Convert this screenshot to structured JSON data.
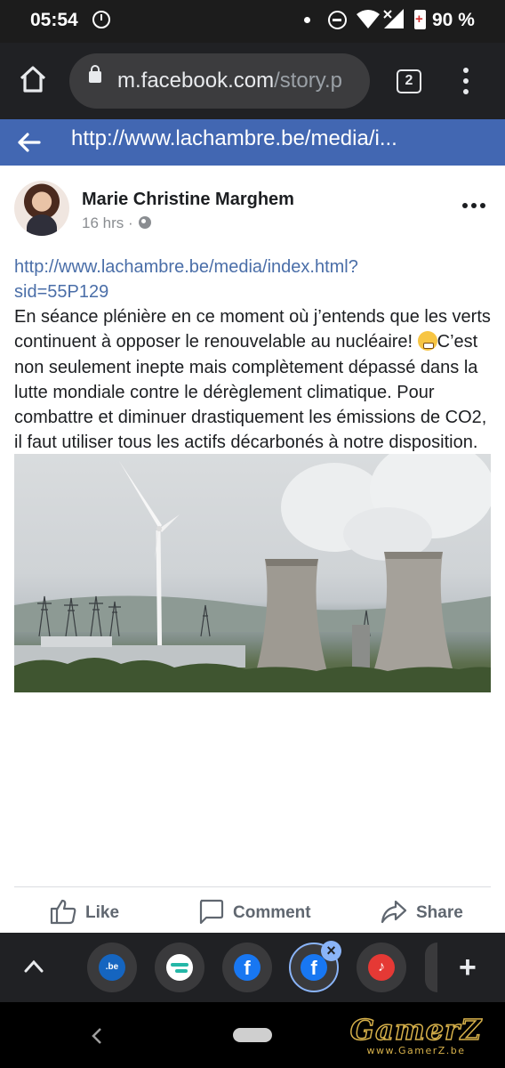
{
  "status_bar": {
    "time": "05:54",
    "battery_percent": "90 %"
  },
  "browser": {
    "url_domain": "m.facebook.com",
    "url_path": "/story.p",
    "tab_count": "2"
  },
  "fb_header": {
    "title": "http://www.lachambre.be/media/i..."
  },
  "post": {
    "author": "Marie Christine Marghem",
    "time": "16 hrs",
    "separator": " · ",
    "link": "http://www.lachambre.be/media/index.html?sid=55P129",
    "text_part1": "En séance plénière en ce moment où j’entends que les verts continuent à opposer le renouvelable au nucléaire! ",
    "text_part2": "C’est non seulement inepte mais complètement dépassé dans la lutte mondiale contre le dérèglement climatique. Pour combattre et diminuer drastiquement les émissions de CO2, il faut utiliser tous les actifs décarbonés à notre disposition. L’idéologie ringarde verte qui veut installer des centrales au gaz en Belgique nous mène droit dans le mur et est en pleine contradiction avec ce qu’elle prétend défendre: un monde sain à transmettre aux générations futures."
  },
  "actions": {
    "like": "Like",
    "comment": "Comment",
    "share": "Share"
  },
  "bubbles": {
    "be_label": ".be",
    "fb_label": "f",
    "close": "×",
    "plus": "+"
  },
  "watermark": {
    "main": "GamerZ",
    "sub": "www.GamerZ.be"
  },
  "colors": {
    "facebook_blue": "#4267b2",
    "link": "#4a6ea8",
    "toolbar": "#202124"
  }
}
